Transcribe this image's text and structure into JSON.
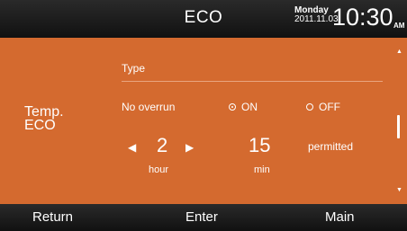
{
  "header": {
    "title": "ECO",
    "day": "Monday",
    "date": "2011.11.03",
    "time": "10:30",
    "ampm": "AM"
  },
  "panel": {
    "side_label_line1": "Temp.",
    "side_label_line2": "ECO",
    "type_label": "Type",
    "row_label": "No overrun",
    "radio_on_label": "ON",
    "radio_off_label": "OFF",
    "selected": "ON",
    "hour_value": "2",
    "min_value": "15",
    "permitted_label": "permitted",
    "hour_unit": "hour",
    "min_unit": "min"
  },
  "footer": {
    "return_label": "Return",
    "enter_label": "Enter",
    "main_label": "Main"
  },
  "colors": {
    "panel": "#d46a2f",
    "bars": "#1a1a1a"
  }
}
